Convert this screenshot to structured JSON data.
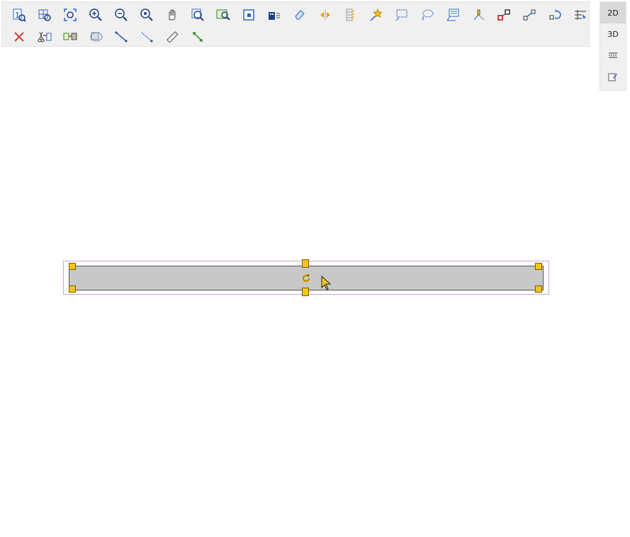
{
  "toolbar": {
    "row1": [
      {
        "icon": "zoom-1-to-1-icon",
        "glyph": "1"
      },
      {
        "icon": "zoom-grid-icon"
      },
      {
        "icon": "zoom-fit-icon"
      },
      {
        "icon": "zoom-in-icon"
      },
      {
        "icon": "zoom-out-icon"
      },
      {
        "icon": "zoom-previous-icon"
      },
      {
        "icon": "pan-hand-icon"
      },
      {
        "icon": "zoom-window-icon"
      },
      {
        "icon": "zoom-objects-icon"
      },
      {
        "icon": "page-frame-icon"
      },
      {
        "icon": "building-icon"
      },
      {
        "icon": "eraser-icon"
      },
      {
        "icon": "mirror-icon"
      },
      {
        "icon": "list-icon"
      },
      {
        "icon": "star-select-icon"
      },
      {
        "icon": "rect-select-icon"
      },
      {
        "icon": "lasso-select-icon"
      },
      {
        "icon": "label-icon"
      },
      {
        "icon": "offset-icon"
      },
      {
        "icon": "connect-nodes-icon"
      },
      {
        "icon": "stretch-icon"
      },
      {
        "icon": "rotate-node-icon"
      },
      {
        "icon": "measure-grid-icon"
      }
    ],
    "row2": [
      {
        "icon": "close-icon"
      },
      {
        "icon": "cut-edit-icon"
      },
      {
        "icon": "convert-block-icon"
      },
      {
        "icon": "dashed-outline-icon"
      },
      {
        "icon": "line-snap-icon"
      },
      {
        "icon": "dotted-line-icon"
      },
      {
        "icon": "ruler-icon"
      },
      {
        "icon": "dimension-arrow-icon"
      }
    ]
  },
  "view": {
    "mode_2d": "2D",
    "mode_3d": "3D",
    "active": "2D"
  },
  "colors": {
    "accent_blue": "#2a64c8",
    "handle": "#f5c518",
    "wall_fill": "#c8c8c8",
    "selection": "#c8a9c8"
  }
}
